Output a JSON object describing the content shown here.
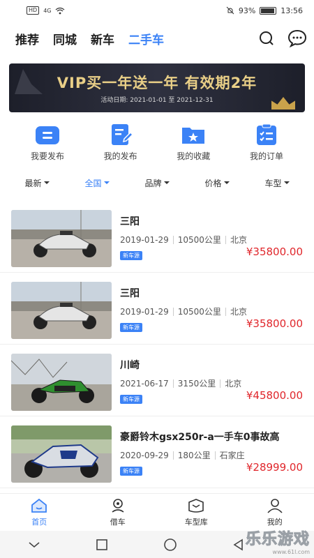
{
  "status_bar": {
    "hd": "HD",
    "network": "4G",
    "battery": "93%",
    "time": "13:56"
  },
  "top_nav": {
    "tabs": [
      "推荐",
      "同城",
      "新车",
      "二手车"
    ],
    "active_index": 3
  },
  "banner": {
    "title": "VIP买一年送一年 有效期2年",
    "date": "活动日期: 2021-01-01 至 2021-12-31"
  },
  "quick_actions": [
    {
      "label": "我要发布",
      "icon": "publish-icon"
    },
    {
      "label": "我的发布",
      "icon": "edit-doc-icon"
    },
    {
      "label": "我的收藏",
      "icon": "favorite-folder-icon"
    },
    {
      "label": "我的订单",
      "icon": "order-list-icon"
    }
  ],
  "filters": [
    "最新",
    "全国",
    "品牌",
    "价格",
    "车型"
  ],
  "listings": [
    {
      "title": "三阳",
      "date": "2019-01-29",
      "mileage": "10500公里",
      "city": "北京",
      "badge": "新车源",
      "price": "¥35800.00"
    },
    {
      "title": "三阳",
      "date": "2019-01-29",
      "mileage": "10500公里",
      "city": "北京",
      "badge": "新车源",
      "price": "¥35800.00"
    },
    {
      "title": "川崎",
      "date": "2021-06-17",
      "mileage": "3150公里",
      "city": "北京",
      "badge": "新车源",
      "price": "¥45800.00"
    },
    {
      "title": "豪爵铃木gsx250r-a一手车0事故高",
      "date": "2020-09-29",
      "mileage": "180公里",
      "city": "石家庄",
      "badge": "新车源",
      "price": "¥28999.00"
    }
  ],
  "bottom_tabs": [
    {
      "label": "首页",
      "icon": "home-icon"
    },
    {
      "label": "借车",
      "icon": "borrow-car-icon"
    },
    {
      "label": "车型库",
      "icon": "model-library-icon"
    },
    {
      "label": "我的",
      "icon": "profile-icon"
    }
  ],
  "watermark": {
    "brand": "乐乐游戏",
    "url": "www.61l.com"
  },
  "colors": {
    "accent": "#3b82f6",
    "price": "#e0262b",
    "banner_gold": "#e9cf87"
  }
}
